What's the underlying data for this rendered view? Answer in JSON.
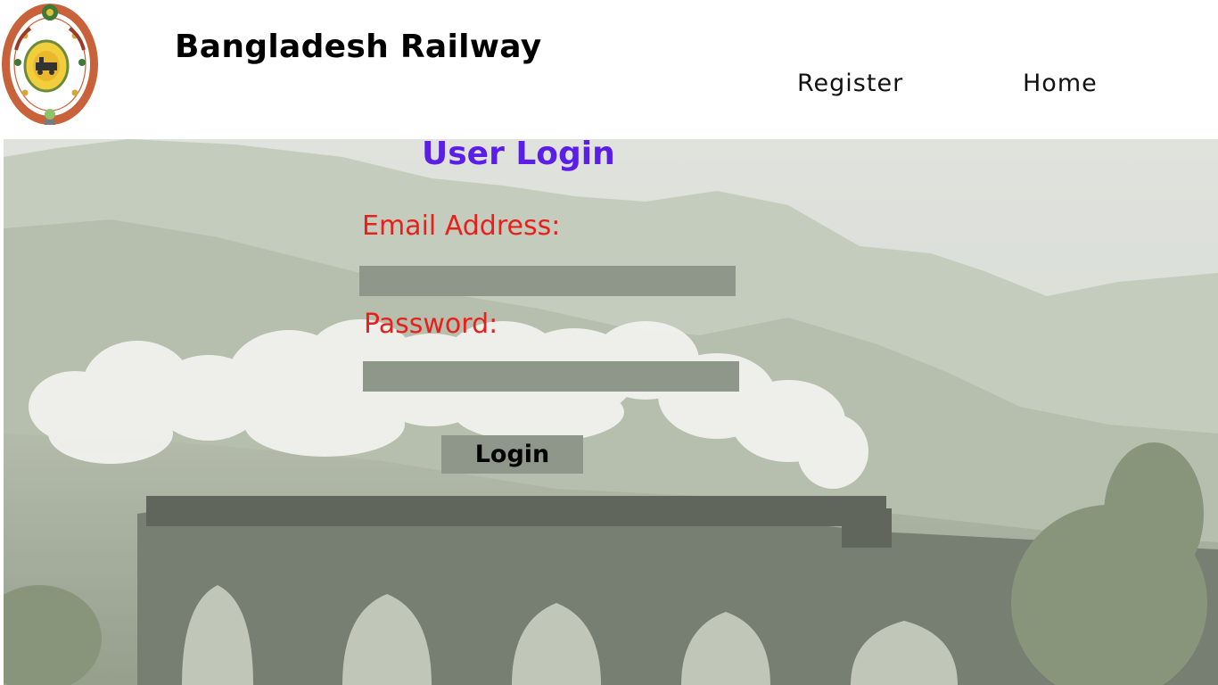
{
  "header": {
    "brand_title": "Bangladesh Railway",
    "logo_icon": "bangladesh-railway-emblem-icon",
    "nav": {
      "register_label": "Register",
      "home_label": "Home"
    }
  },
  "login": {
    "title": "User Login",
    "email_label": "Email Address:",
    "email_value": "",
    "password_label": "Password:",
    "password_value": "",
    "submit_label": "Login"
  },
  "background": {
    "image_icon": "steam-train-on-viaduct-image"
  },
  "colors": {
    "title": "#5b1ee6",
    "label": "#e8201c",
    "input_fill": "#8f968a",
    "button_fill": "#8f968a",
    "logo_ring": "#c8623a"
  }
}
